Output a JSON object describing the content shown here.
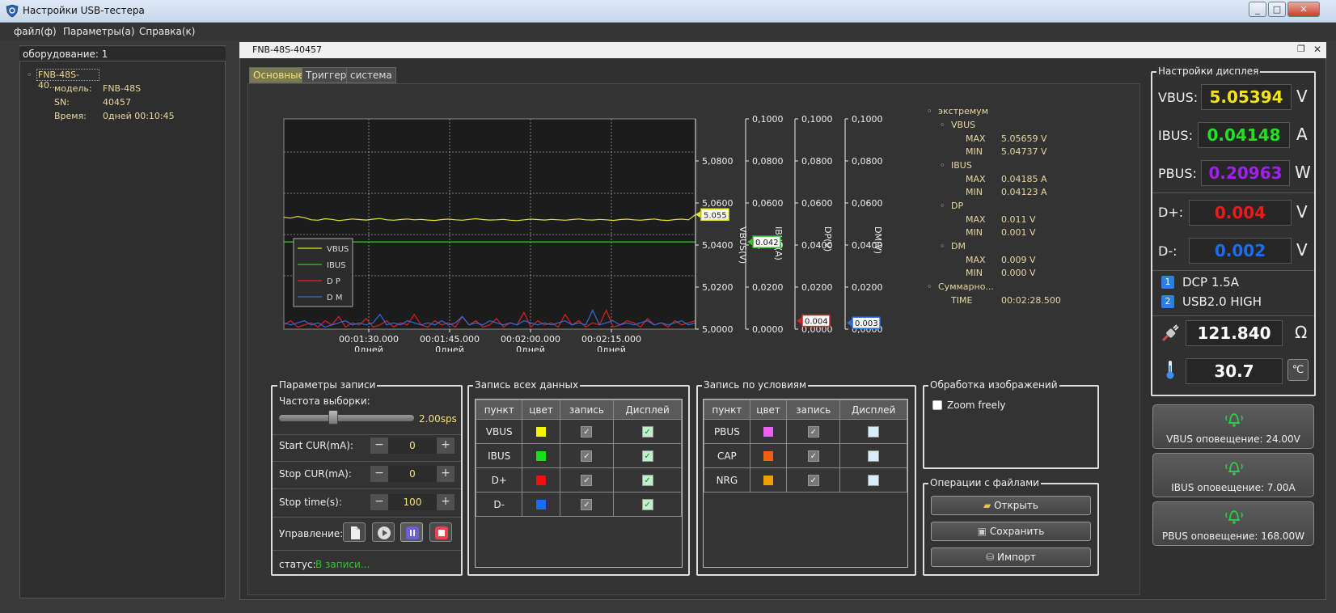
{
  "window": {
    "title": "Настройки USB-тестера"
  },
  "menu": [
    "файл(ф)",
    "Параметры(а)",
    "Справка(к)"
  ],
  "left": {
    "equipment_label": "оборудование: 1",
    "device_node": "FNB-48S-40...",
    "props": [
      {
        "k": "модель:",
        "v": "FNB-48S"
      },
      {
        "k": "SN:",
        "v": "40457"
      },
      {
        "k": "Время:",
        "v": "0дней 00:10:45"
      }
    ]
  },
  "mdi": {
    "title": "FNB-48S-40457"
  },
  "tabs": [
    "Основные",
    "Триггер",
    "система"
  ],
  "chart_data": {
    "type": "line",
    "x_ticks": [
      {
        "time": "00:01:30.000",
        "day": "0дней"
      },
      {
        "time": "00:01:45.000",
        "day": "0дней"
      },
      {
        "time": "00:02:00.000",
        "day": "0дней"
      },
      {
        "time": "00:02:15.000",
        "day": "0дней"
      }
    ],
    "axes": [
      {
        "label": "VBUS(V)",
        "ticks": [
          "5,0800",
          "5,0600",
          "5,0400",
          "5,0200",
          "5,0000"
        ],
        "ylim": [
          5.0,
          5.1
        ]
      },
      {
        "label": "IBUS(A)",
        "ticks": [
          "0,1000",
          "0,0800",
          "0,0600",
          "0,0400",
          "0,0200",
          "0,0000"
        ],
        "ylim": [
          0,
          0.1
        ]
      },
      {
        "label": "DP(V)",
        "ticks": [
          "0,1000",
          "0,0800",
          "0,0600",
          "0,0400",
          "0,0200",
          "0,0000"
        ],
        "ylim": [
          0,
          0.1
        ]
      },
      {
        "label": "DM(V)",
        "ticks": [
          "0,1000",
          "0,0800",
          "0,0600",
          "0,0400",
          "0,0200",
          "0,0000"
        ],
        "ylim": [
          0,
          0.1
        ]
      }
    ],
    "legend": [
      "VBUS",
      "IBUS",
      "D P",
      "D M"
    ],
    "legend_position": "bottom-left",
    "grid": true,
    "series": [
      {
        "name": "VBUS",
        "color": "#e5e52a",
        "last": "5.055",
        "values": [
          5.0532,
          5.0528,
          5.0536,
          5.053,
          5.052,
          5.0518,
          5.0525,
          5.0522,
          5.0516,
          5.052,
          5.0524,
          5.0521,
          5.0519,
          5.0523,
          5.0526,
          5.052,
          5.0518,
          5.0521,
          5.0524,
          5.052,
          5.0522,
          5.0519,
          5.0517,
          5.0521,
          5.0523,
          5.052,
          5.0518,
          5.0522,
          5.0525,
          5.0521,
          5.0519,
          5.052,
          5.0522,
          5.0518,
          5.0516,
          5.052,
          5.0523,
          5.0521,
          5.0519,
          5.0522,
          5.052,
          5.0518,
          5.0521,
          5.0524,
          5.052,
          5.0519,
          5.0522,
          5.052,
          5.0517,
          5.0521,
          5.0523,
          5.052,
          5.0518,
          5.0521,
          5.0524,
          5.0519,
          5.0517,
          5.0521,
          5.0523,
          5.052,
          5.0545
        ]
      },
      {
        "name": "IBUS",
        "color": "#2ecc2e",
        "last": "0.042",
        "values": [
          0.0415,
          0.0415,
          0.0415,
          0.0415,
          0.0415,
          0.0415,
          0.0415,
          0.0415,
          0.0415,
          0.0415,
          0.0415,
          0.0415,
          0.0415,
          0.0415,
          0.0415,
          0.0415,
          0.0415,
          0.0415,
          0.0415,
          0.0415,
          0.0415
        ]
      },
      {
        "name": "DP",
        "color": "#e02020",
        "last": "0.004",
        "values": [
          0.002,
          0.004,
          0.001,
          0.002,
          0.003,
          0.001,
          0.004,
          0.002,
          0.006,
          0.001,
          0.003,
          0.002,
          0.005,
          0.001,
          0.002,
          0.004,
          0.001,
          0.003,
          0.002,
          0.007,
          0.002,
          0.001,
          0.004,
          0.002,
          0.003,
          0.001,
          0.006,
          0.002,
          0.004,
          0.001,
          0.002,
          0.005,
          0.001,
          0.003,
          0.002,
          0.008,
          0.001,
          0.004,
          0.002,
          0.003,
          0.001,
          0.007,
          0.002,
          0.004,
          0.001,
          0.003,
          0.002,
          0.009,
          0.001,
          0.002,
          0.004,
          0.003,
          0.001,
          0.005,
          0.002,
          0.003,
          0.001,
          0.004,
          0.002,
          0.003,
          0.004
        ]
      },
      {
        "name": "DM",
        "color": "#2a6fe0",
        "last": "0.003",
        "values": [
          0.003,
          0.002,
          0.003,
          0.004,
          0.002,
          0.003,
          0.001,
          0.002,
          0.003,
          0.004,
          0.002,
          0.003,
          0.002,
          0.003,
          0.007,
          0.002,
          0.003,
          0.002,
          0.004,
          0.003,
          0.002,
          0.003,
          0.002,
          0.004,
          0.002,
          0.003,
          0.006,
          0.002,
          0.003,
          0.002,
          0.004,
          0.003,
          0.002,
          0.003,
          0.002,
          0.004,
          0.003,
          0.002,
          0.003,
          0.002,
          0.003,
          0.004,
          0.002,
          0.003,
          0.002,
          0.009,
          0.002,
          0.003,
          0.004,
          0.002,
          0.003,
          0.002,
          0.003,
          0.004,
          0.002,
          0.003,
          0.002,
          0.003,
          0.004,
          0.002,
          0.003
        ]
      }
    ]
  },
  "extremum": {
    "root": "экстремум",
    "groups": [
      {
        "name": "VBUS",
        "max": "5.05659 V",
        "min": "5.04737 V"
      },
      {
        "name": "IBUS",
        "max": "0.04185 A",
        "min": "0.04123 A"
      },
      {
        "name": "DP",
        "max": "0.011 V",
        "min": "0.001 V"
      },
      {
        "name": "DM",
        "max": "0.009 V",
        "min": "0.000 V"
      }
    ],
    "max_label": "MAX",
    "min_label": "MIN",
    "summary": "Суммарно...",
    "time_label": "TIME",
    "time_value": "00:02:28.500"
  },
  "record_params": {
    "title": "Параметры записи",
    "rate_label": "Частота выборки:",
    "rate_value": "2.00sps",
    "rate_fraction": 0.38,
    "start_label": "Start CUR(mA):",
    "start_value": "0",
    "stop_label": "Stop CUR(mA):",
    "stop_value": "0",
    "time_label": "Stop time(s):",
    "time_value": "100",
    "control_label": "Управление:",
    "status_label": "статус:",
    "status_value": "В записи..."
  },
  "all_data": {
    "title": "Запись всех данных",
    "headers": [
      "пункт",
      "цвет",
      "запись",
      "Дисплей"
    ],
    "rows": [
      {
        "item": "VBUS",
        "color": "#f5f500",
        "rec": true,
        "disp": true
      },
      {
        "item": "IBUS",
        "color": "#18e018",
        "rec": true,
        "disp": true
      },
      {
        "item": "D+",
        "color": "#f00f0f",
        "rec": true,
        "disp": true
      },
      {
        "item": "D-",
        "color": "#1a6cf0",
        "rec": true,
        "disp": true
      }
    ]
  },
  "cond_data": {
    "title": "Запись по условиям",
    "headers": [
      "пункт",
      "цвет",
      "запись",
      "Дисплей"
    ],
    "rows": [
      {
        "item": "PBUS",
        "color": "#f060f0",
        "rec": true,
        "disp": false
      },
      {
        "item": "CAP",
        "color": "#f06010",
        "rec": true,
        "disp": false
      },
      {
        "item": "NRG",
        "color": "#f0a000",
        "rec": true,
        "disp": false
      }
    ]
  },
  "image_proc": {
    "title": "Обработка изображений",
    "zoom_label": "Zoom freely"
  },
  "file_ops": {
    "title": "Операции с файлами",
    "open": "Открыть",
    "save": "Сохранить",
    "import": "Импорт"
  },
  "display": {
    "title": "Настройки дисплея",
    "vbus": {
      "label": "VBUS:",
      "value": "5.05394",
      "unit": "V",
      "color": "#f5e31a"
    },
    "ibus": {
      "label": "IBUS:",
      "value": "0.04148",
      "unit": "A",
      "color": "#22e022"
    },
    "pbus": {
      "label": "PBUS:",
      "value": "0.20963",
      "unit": "W",
      "color": "#a020f0"
    },
    "dp": {
      "label": "D+:",
      "value": "0.004",
      "unit": "V",
      "color": "#f01818"
    },
    "dm": {
      "label": "D-:",
      "value": "0.002",
      "unit": "V",
      "color": "#1a6cf0"
    },
    "proto1": {
      "num": "1",
      "text": "DCP 1.5A"
    },
    "proto2": {
      "num": "2",
      "text": "USB2.0 HIGH"
    },
    "resistance": {
      "value": "121.840",
      "unit": "Ω"
    },
    "temperature": {
      "value": "30.7",
      "unit": "℃"
    }
  },
  "alarms": [
    {
      "label": "VBUS оповещение: 24.00V"
    },
    {
      "label": "IBUS оповещение: 7.00A"
    },
    {
      "label": "PBUS оповещение: 168.00W"
    }
  ]
}
